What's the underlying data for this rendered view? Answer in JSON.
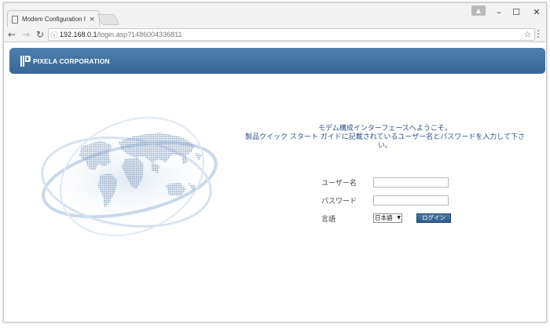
{
  "browser": {
    "tab_title": "Modem Configuration In",
    "tab_close": "×",
    "url_host": "192.168.0.1",
    "url_path": "/login.asp?1486004336811",
    "controls": {
      "minimize": "–",
      "maximize": "☐",
      "close": "✕"
    }
  },
  "banner": {
    "company": "PIXELA CORPORATION",
    "color": "#3d6e9c"
  },
  "welcome": {
    "line1": "モデム構成インターフェースへようこそ。",
    "line2": "製品クイック スタート ガイドに記載されているユーザー名とパスワードを入力して下さい。"
  },
  "form": {
    "username_label": "ユーザー名",
    "username_value": "",
    "password_label": "パスワード",
    "password_value": "",
    "language_label": "言語",
    "language_selected": "日本語",
    "login_button": "ログイン"
  },
  "icons": [
    "document-icon",
    "back-icon",
    "forward-icon",
    "reload-icon",
    "info-icon",
    "star-icon",
    "menu-icon",
    "world-map-graphic"
  ]
}
